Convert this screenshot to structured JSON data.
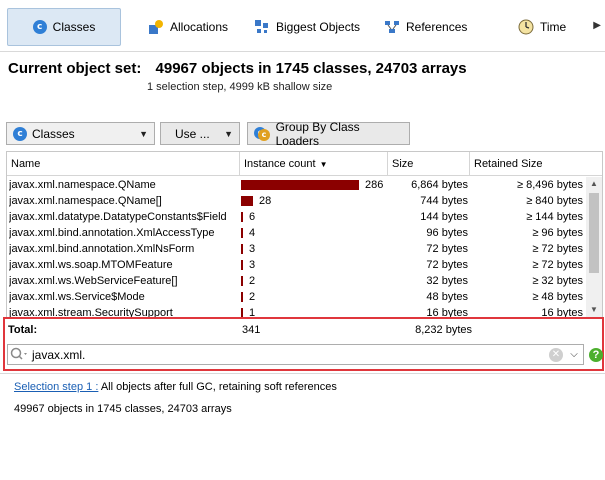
{
  "tabs": [
    {
      "label": "Classes",
      "icon": "classes-icon"
    },
    {
      "label": "Allocations",
      "icon": "allocations-icon"
    },
    {
      "label": "Biggest Objects",
      "icon": "biggest-objects-icon"
    },
    {
      "label": "References",
      "icon": "references-icon"
    },
    {
      "label": "Time",
      "icon": "time-icon"
    }
  ],
  "header": {
    "title_label": "Current object set:",
    "title_value": "49967 objects in 1745 classes, 24703 arrays",
    "subtitle": "1 selection step, 4999 kB shallow size"
  },
  "controls": {
    "view_select": "Classes",
    "use_button": "Use ...",
    "group_button": "Group By Class Loaders"
  },
  "table": {
    "columns": [
      "Name",
      "Instance count",
      "Size",
      "Retained Size"
    ],
    "rows": [
      {
        "name": "javax.xml.namespace.QName",
        "count": "286",
        "count_value": 286,
        "size": "6,864 bytes",
        "retained": "≥ 8,496 bytes"
      },
      {
        "name": "javax.xml.namespace.QName[]",
        "count": "28",
        "count_value": 28,
        "size": "744 bytes",
        "retained": "≥ 840 bytes"
      },
      {
        "name": "javax.xml.datatype.DatatypeConstants$Field",
        "count": "6",
        "count_value": 6,
        "size": "144 bytes",
        "retained": "≥ 144 bytes"
      },
      {
        "name": "javax.xml.bind.annotation.XmlAccessType",
        "count": "4",
        "count_value": 4,
        "size": "96 bytes",
        "retained": "≥ 96 bytes"
      },
      {
        "name": "javax.xml.bind.annotation.XmlNsForm",
        "count": "3",
        "count_value": 3,
        "size": "72 bytes",
        "retained": "≥ 72 bytes"
      },
      {
        "name": "javax.xml.ws.soap.MTOMFeature",
        "count": "3",
        "count_value": 3,
        "size": "72 bytes",
        "retained": "≥ 72 bytes"
      },
      {
        "name": "javax.xml.ws.WebServiceFeature[]",
        "count": "2",
        "count_value": 2,
        "size": "32 bytes",
        "retained": "≥ 32 bytes"
      },
      {
        "name": "javax.xml.ws.Service$Mode",
        "count": "2",
        "count_value": 2,
        "size": "48 bytes",
        "retained": "≥ 48 bytes"
      },
      {
        "name": "javax.xml.stream.SecuritySupport",
        "count": "1",
        "count_value": 1,
        "size": "16 bytes",
        "retained": "16 bytes"
      }
    ],
    "max_count": 286,
    "bar_color": "#8b0000"
  },
  "total": {
    "label": "Total:",
    "count": "341",
    "size": "8,232 bytes"
  },
  "filter": {
    "value": "javax.xml."
  },
  "selection": {
    "link": "Selection step 1 :",
    "description": "All objects after full GC, retaining soft references",
    "info": "49967 objects in 1745 classes, 24703 arrays"
  },
  "colors": {
    "highlight_border": "#e0363c",
    "active_tab": "#dce8f4",
    "help": "#4caf2e"
  }
}
